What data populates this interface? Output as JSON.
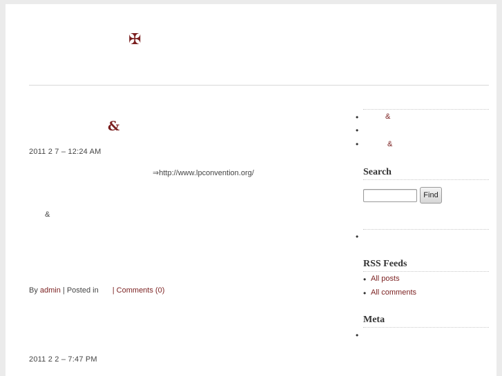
{
  "header": {
    "logo_glyph": "✠"
  },
  "posts": [
    {
      "title": "&",
      "date": "2011 2 7  – 12:24 AM",
      "body_link": "⇒http://www.lpconvention.org/",
      "body_amp": "&",
      "meta": {
        "by": "By ",
        "author": "admin",
        "posted_in": " | Posted in ",
        "comments": "| Comments (0)"
      }
    },
    {
      "date": "2011 2 2  – 7:47 PM"
    }
  ],
  "sidebar": {
    "top_list": [
      {
        "bullet": "•",
        "label": "&"
      },
      {
        "bullet": "•",
        "label": ""
      },
      {
        "bullet": "•",
        "label": "&"
      }
    ],
    "search": {
      "title": "Search",
      "value": "",
      "button": "Find"
    },
    "empty_list": [
      {
        "bullet": "•"
      }
    ],
    "rss": {
      "title": "RSS Feeds",
      "items": [
        {
          "bullet": "•",
          "label": "All posts"
        },
        {
          "bullet": "•",
          "label": "All comments"
        }
      ]
    },
    "meta": {
      "title": "Meta",
      "items": [
        {
          "bullet": "•"
        }
      ]
    }
  },
  "colors": {
    "accent": "#7a1f1f",
    "background": "#ebebeb",
    "page": "#ffffff"
  }
}
